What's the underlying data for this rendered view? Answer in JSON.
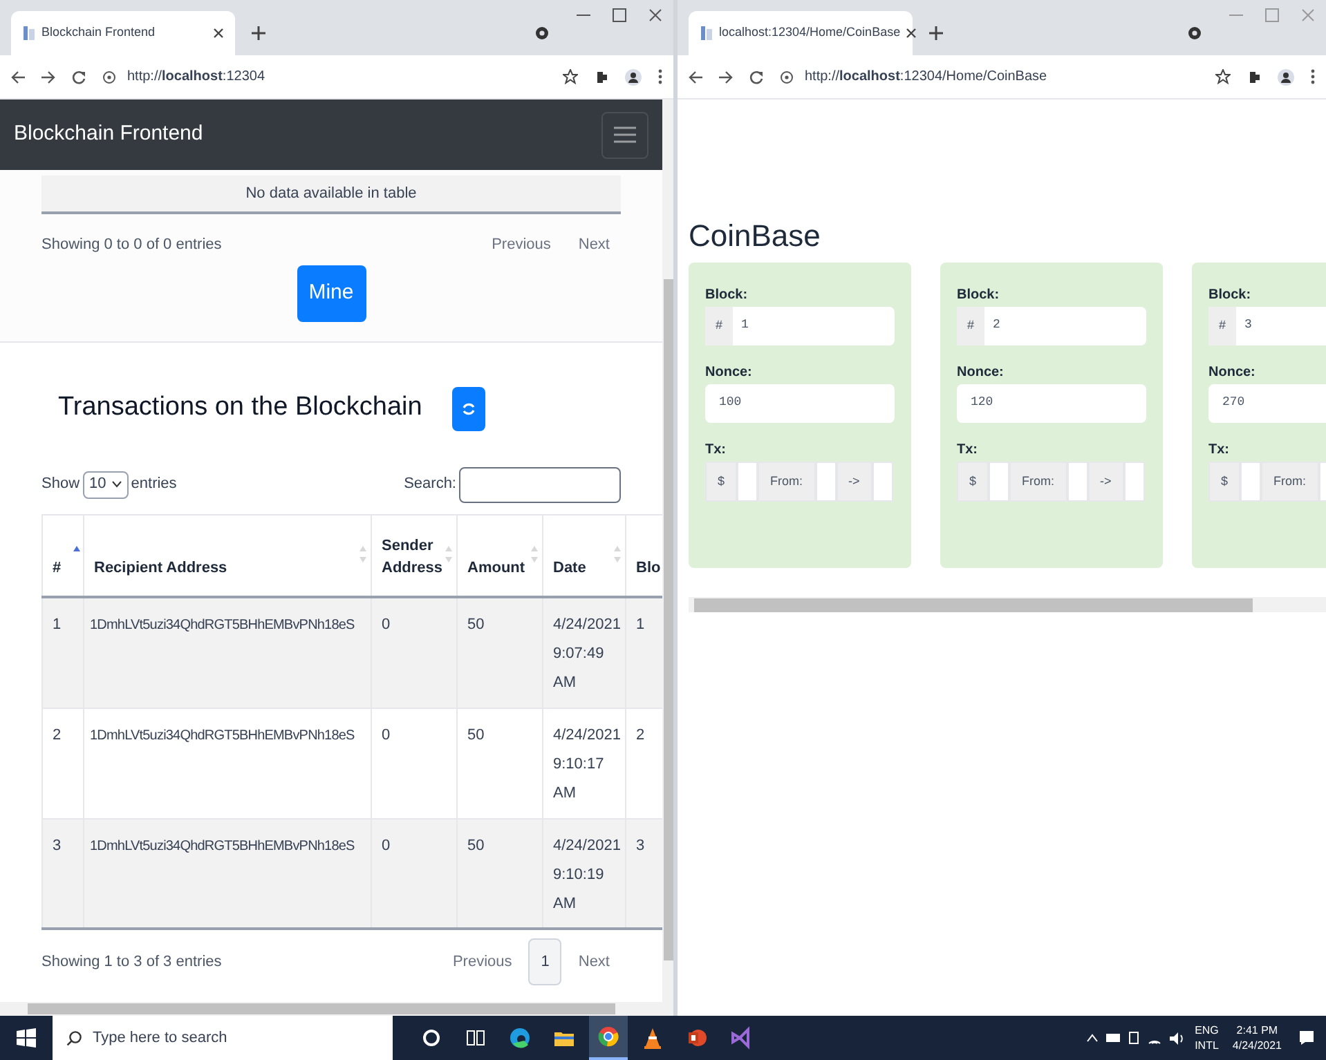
{
  "left_browser": {
    "tabs": [
      {
        "title": "Blockchain Frontend",
        "selected": true
      }
    ],
    "address": "http://**localhost**:12304",
    "navbar": {
      "brand": "Blockchain Frontend"
    },
    "pending": {
      "empty_message": "No data available in table",
      "info": "Showing 0 to 0 of 0 entries",
      "previous": "Previous",
      "next": "Next"
    },
    "mine_button": "Mine",
    "transactions": {
      "heading": "Transactions on the Blockchain",
      "show_label": "Show",
      "length": "10",
      "entries_label": "entries",
      "search_label": "Search:",
      "columns": [
        {
          "label": "#",
          "sorted": true
        },
        {
          "label": "Recipient Address",
          "sorted": false
        },
        {
          "label": "Sender Address",
          "sorted": false
        },
        {
          "label": "Amount",
          "sorted": false
        },
        {
          "label": "Date",
          "sorted": false
        },
        {
          "label": "Blo"
        }
      ],
      "rows": [
        [
          "1",
          "1DmhLVt5uzi34QhdRGT5BHhEMBvPNh18eS",
          "0",
          "50",
          "4/24/2021 9:07:49 AM",
          "1"
        ],
        [
          "2",
          "1DmhLVt5uzi34QhdRGT5BHhEMBvPNh18eS",
          "0",
          "50",
          "4/24/2021 9:10:17 AM",
          "2"
        ],
        [
          "3",
          "1DmhLVt5uzi34QhdRGT5BHhEMBvPNh18eS",
          "0",
          "50",
          "4/24/2021 9:10:19 AM",
          "3"
        ]
      ],
      "info": "Showing 1 to 3 of 3 entries",
      "previous": "Previous",
      "pages": [
        {
          "label": "1",
          "selected": true
        }
      ],
      "next": "Next"
    }
  },
  "right_browser": {
    "tabs": [
      {
        "title": "localhost:12304/Home/CoinBase",
        "selected": true
      }
    ],
    "address": "http://**localhost**:12304/Home/CoinBase",
    "heading": "CoinBase",
    "blocks": [
      {
        "block_label": "Block:",
        "block_prefix": "#",
        "block": "1",
        "nonce_label": "Nonce:",
        "nonce": "100",
        "tx_label": "Tx:",
        "tx_addons": [
          "$",
          "From:",
          "->"
        ]
      },
      {
        "block_label": "Block:",
        "block_prefix": "#",
        "block": "2",
        "nonce_label": "Nonce:",
        "nonce": "120",
        "tx_label": "Tx:",
        "tx_addons": [
          "$",
          "From:",
          "->"
        ]
      },
      {
        "block_label": "Block:",
        "block_prefix": "#",
        "block": "3",
        "nonce_label": "Nonce:",
        "nonce": "270",
        "tx_label": "Tx:",
        "tx_addons": [
          "$",
          "From:"
        ]
      }
    ]
  },
  "taskbar": {
    "search_placeholder": "Type here to search",
    "apps": [
      {
        "kind": "cortana",
        "selected": false
      },
      {
        "kind": "taskview",
        "selected": false
      },
      {
        "kind": "edge",
        "selected": false
      },
      {
        "kind": "files",
        "selected": false
      },
      {
        "kind": "chrome",
        "selected": true
      },
      {
        "kind": "vlc",
        "selected": false
      },
      {
        "kind": "office",
        "selected": false
      },
      {
        "kind": "studio",
        "selected": false
      }
    ],
    "language": [
      "ENG",
      "INTL"
    ],
    "clock": [
      "2:41 PM",
      "4/24/2021"
    ]
  }
}
